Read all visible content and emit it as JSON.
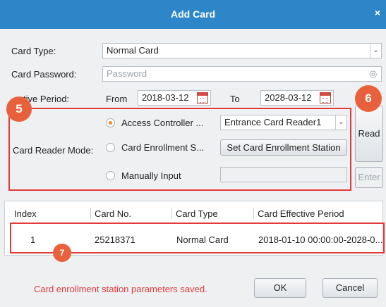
{
  "dialog": {
    "title": "Add Card",
    "close_symbol": "×"
  },
  "form": {
    "card_type": {
      "label": "Card Type:",
      "value": "Normal Card"
    },
    "card_password": {
      "label": "Card Password:",
      "placeholder": "Password"
    },
    "effective_period": {
      "label": "tive Period:",
      "from_label": "From",
      "from_value": "2018-03-12",
      "to_label": "To",
      "to_value": "2028-03-12"
    },
    "card_reader_mode": {
      "label": "Card Reader Mode:",
      "options": [
        {
          "label": "Access Controller ...",
          "checked": true
        },
        {
          "label": "Card Enrollment S...",
          "checked": false
        },
        {
          "label": "Manually Input",
          "checked": false
        }
      ],
      "reader_select": "Entrance Card Reader1",
      "set_station_button": "Set Card Enrollment Station"
    },
    "read_button": "Read",
    "enter_button": "Enter"
  },
  "badges": [
    "5",
    "6",
    "7"
  ],
  "table": {
    "columns": [
      "Index",
      "Card No.",
      "Card Type",
      "Card Effective Period"
    ],
    "rows": [
      [
        "1",
        "25218371",
        "Normal Card",
        "2018-01-10 00:00:00-2028-0..."
      ]
    ]
  },
  "footer": {
    "status_message": "Card enrollment station parameters saved.",
    "ok_button": "OK",
    "cancel_button": "Cancel"
  },
  "colors": {
    "title_bar": "#2d86c8",
    "highlight": "#e23a3a",
    "badge": "#e8613c",
    "radio_selected": "#f08a24"
  }
}
